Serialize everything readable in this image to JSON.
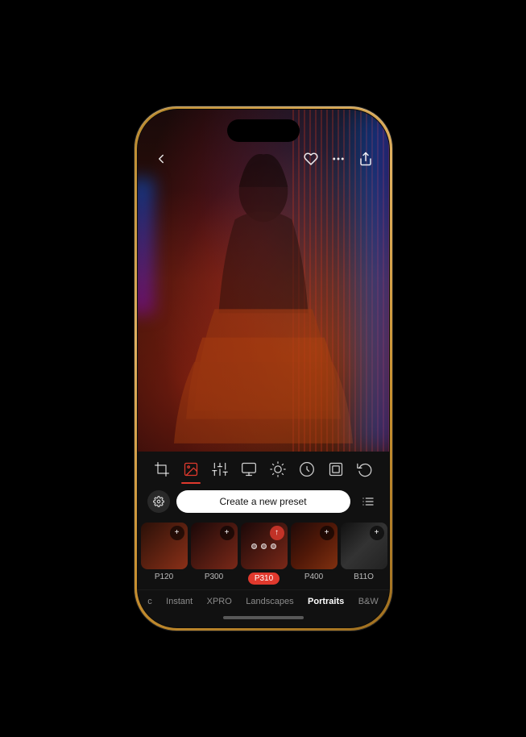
{
  "phone": {
    "dynamic_island": "Dynamic Island"
  },
  "header": {
    "back_icon": "chevron-left",
    "heart_icon": "heart",
    "more_icon": "ellipsis",
    "share_icon": "share"
  },
  "toolbar": {
    "icons": [
      {
        "id": "crop",
        "label": "Crop",
        "active": false
      },
      {
        "id": "photo",
        "label": "Photo",
        "active": true
      },
      {
        "id": "adjust",
        "label": "Adjust",
        "active": false
      },
      {
        "id": "filter",
        "label": "Filter",
        "active": false
      },
      {
        "id": "effects",
        "label": "Effects",
        "active": false
      },
      {
        "id": "retouch",
        "label": "Retouch",
        "active": false
      },
      {
        "id": "frame",
        "label": "Frame",
        "active": false
      },
      {
        "id": "history",
        "label": "History",
        "active": false
      }
    ]
  },
  "presets_bar": {
    "create_preset_label": "Create a new preset",
    "settings_icon": "settings",
    "list_icon": "list"
  },
  "presets": [
    {
      "id": "p120",
      "label": "P120",
      "active": false,
      "loading": false
    },
    {
      "id": "p300",
      "label": "P300",
      "active": false,
      "loading": false
    },
    {
      "id": "p310",
      "label": "P310",
      "active": true,
      "loading": true
    },
    {
      "id": "p400",
      "label": "P400",
      "active": false,
      "loading": false
    },
    {
      "id": "b110",
      "label": "B11O",
      "active": false,
      "loading": false
    }
  ],
  "categories": [
    {
      "id": "classic",
      "label": "c",
      "active": false
    },
    {
      "id": "instant",
      "label": "Instant",
      "active": false
    },
    {
      "id": "xpro",
      "label": "XPRO",
      "active": false
    },
    {
      "id": "landscapes",
      "label": "Landscapes",
      "active": false
    },
    {
      "id": "portraits",
      "label": "Portraits",
      "active": true
    },
    {
      "id": "bw",
      "label": "B&W",
      "active": false
    }
  ],
  "colors": {
    "accent": "#e0392d",
    "active_tab": "#ffffff",
    "inactive_tab": "rgba(255,255,255,0.5)",
    "bg": "#111111"
  }
}
